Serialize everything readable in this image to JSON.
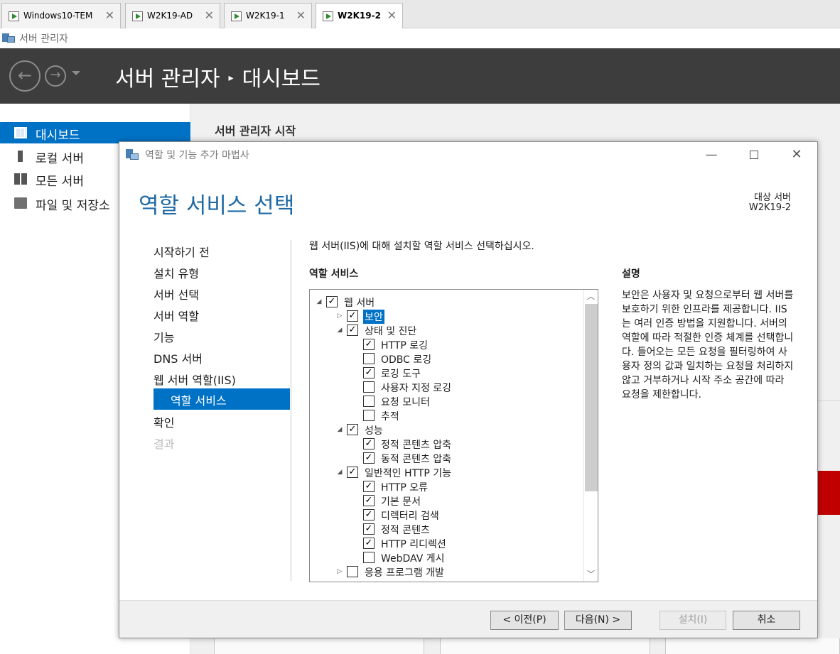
{
  "vm_tabs": [
    {
      "label": "Windows10-TEM"
    },
    {
      "label": "W2K19-AD"
    },
    {
      "label": "W2K19-1"
    },
    {
      "label": "W2K19-2"
    }
  ],
  "app": {
    "title": "서버 관리자",
    "breadcrumb_root": "서버 관리자",
    "breadcrumb_sep": "▸",
    "breadcrumb_page": "대시보드"
  },
  "left_nav": [
    {
      "label": "대시보드",
      "icon": "dashboard-icon"
    },
    {
      "label": "로컬 서버",
      "icon": "local-server-icon"
    },
    {
      "label": "모든 서버",
      "icon": "all-servers-icon"
    },
    {
      "label": "파일 및 저장소",
      "icon": "file-storage-icon"
    }
  ],
  "main": {
    "title": "서버 관리자 시작"
  },
  "dialog": {
    "title": "역할 및 기능 추가 마법사",
    "heading": "역할 서비스 선택",
    "destination_label": "대상 서버",
    "destination_value": "W2K19-2",
    "steps": [
      {
        "label": "시작하기 전"
      },
      {
        "label": "설치 유형"
      },
      {
        "label": "서버 선택"
      },
      {
        "label": "서버 역할"
      },
      {
        "label": "기능"
      },
      {
        "label": "DNS 서버"
      },
      {
        "label": "웹 서버 역할(IIS)"
      },
      {
        "label": "역할 서비스"
      },
      {
        "label": "확인"
      },
      {
        "label": "결과"
      }
    ],
    "instruction": "웹 서버(IIS)에 대해 설치할 역할 서비스 선택하십시오.",
    "role_services_header": "역할 서비스",
    "description_header": "설명",
    "description_text": "보안은 사용자 및 요청으로부터 웹 서버를 보호하기 위한 인프라를 제공합니다. IIS는 여러 인증 방법을 지원합니다. 서버의 역할에 따라 적절한 인증 체계를 선택합니다. 들어오는 모든 요청을 필터링하여 사용자 정의 값과 일치하는 요청을 처리하지 않고 거부하거나 시작 주소 공간에 따라 요청을 제한합니다.",
    "tree": [
      {
        "label": "웹 서버",
        "checked": true,
        "expander": "◢"
      },
      {
        "label": "보안",
        "checked": true,
        "expander": "▷",
        "highlighted": true
      },
      {
        "label": "상태 및 진단",
        "checked": true,
        "expander": "◢"
      },
      {
        "label": "HTTP 로깅",
        "checked": true
      },
      {
        "label": "ODBC 로깅",
        "checked": false
      },
      {
        "label": "로깅 도구",
        "checked": true
      },
      {
        "label": "사용자 지정 로깅",
        "checked": false
      },
      {
        "label": "요청 모니터",
        "checked": false
      },
      {
        "label": "추적",
        "checked": false
      },
      {
        "label": "성능",
        "checked": true,
        "expander": "◢"
      },
      {
        "label": "정적 콘텐츠 압축",
        "checked": true
      },
      {
        "label": "동적 콘텐츠 압축",
        "checked": true
      },
      {
        "label": "일반적인 HTTP 기능",
        "checked": true,
        "expander": "◢"
      },
      {
        "label": "HTTP 오류",
        "checked": true
      },
      {
        "label": "기본 문서",
        "checked": true
      },
      {
        "label": "디렉터리 검색",
        "checked": true
      },
      {
        "label": "정적 콘텐츠",
        "checked": true
      },
      {
        "label": "HTTP 리디렉션",
        "checked": true
      },
      {
        "label": "WebDAV 게시",
        "checked": false
      },
      {
        "label": "응용 프로그램 개발",
        "checked": false,
        "expander": "▷"
      }
    ],
    "buttons": {
      "prev": "< 이전(P)",
      "next": "다음(N) >",
      "install": "설치(I)",
      "cancel": "취소"
    }
  },
  "colors": {
    "accent": "#0072c6",
    "heading": "#1f6aa5",
    "header_bg": "#3d3d3d",
    "alert": "#c00000"
  }
}
